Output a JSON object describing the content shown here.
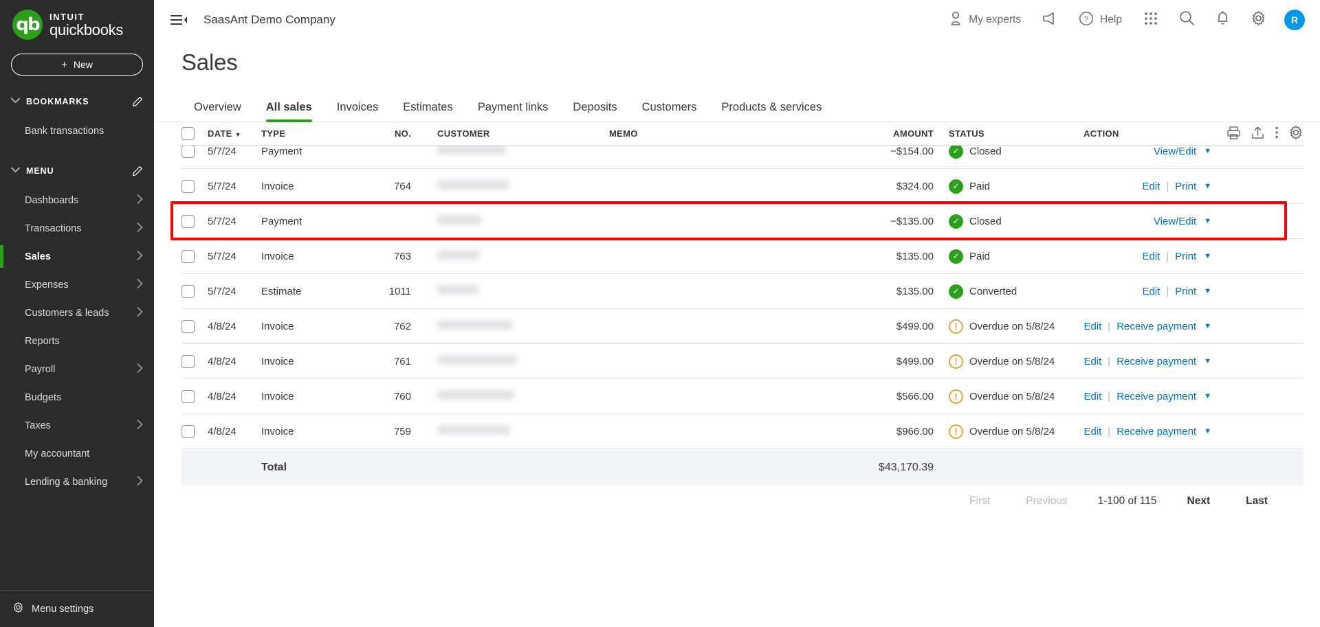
{
  "brand": {
    "intuit": "INTUIT",
    "product": "quickbooks",
    "logo_letters": "qb"
  },
  "sidebar": {
    "new_button": "New",
    "plus": "+",
    "bookmarks_header": "BOOKMARKS",
    "bookmarks": [
      {
        "label": "Bank transactions"
      }
    ],
    "menu_header": "MENU",
    "menu": [
      {
        "label": "Dashboards",
        "has_arrow": true,
        "active": false
      },
      {
        "label": "Transactions",
        "has_arrow": true,
        "active": false
      },
      {
        "label": "Sales",
        "has_arrow": true,
        "active": true
      },
      {
        "label": "Expenses",
        "has_arrow": true,
        "active": false
      },
      {
        "label": "Customers & leads",
        "has_arrow": true,
        "active": false
      },
      {
        "label": "Reports",
        "has_arrow": false,
        "active": false
      },
      {
        "label": "Payroll",
        "has_arrow": true,
        "active": false
      },
      {
        "label": "Budgets",
        "has_arrow": false,
        "active": false
      },
      {
        "label": "Taxes",
        "has_arrow": true,
        "active": false
      },
      {
        "label": "My accountant",
        "has_arrow": false,
        "active": false
      },
      {
        "label": "Lending & banking",
        "has_arrow": true,
        "active": false
      }
    ],
    "menu_settings": "Menu settings"
  },
  "topbar": {
    "company": "SaasAnt Demo Company",
    "my_experts": "My experts",
    "help": "Help",
    "avatar_initial": "R"
  },
  "page": {
    "title": "Sales"
  },
  "tabs": [
    {
      "label": "Overview",
      "active": false
    },
    {
      "label": "All sales",
      "active": true
    },
    {
      "label": "Invoices",
      "active": false
    },
    {
      "label": "Estimates",
      "active": false
    },
    {
      "label": "Payment links",
      "active": false
    },
    {
      "label": "Deposits",
      "active": false
    },
    {
      "label": "Customers",
      "active": false
    },
    {
      "label": "Products & services",
      "active": false
    }
  ],
  "table": {
    "columns": {
      "date": "DATE",
      "sort_caret": "▼",
      "type": "TYPE",
      "no": "NO.",
      "customer": "CUSTOMER",
      "memo": "MEMO",
      "amount": "AMOUNT",
      "status": "STATUS",
      "action": "ACTION"
    },
    "rows": [
      {
        "date": "5/7/24",
        "type": "Payment",
        "no": "",
        "customer_width": 100,
        "amount": "−$154.00",
        "status": "Closed",
        "status_kind": "ok",
        "actions": [
          "View/Edit"
        ],
        "caret": "▼",
        "partial": true,
        "highlighted": false
      },
      {
        "date": "5/7/24",
        "type": "Invoice",
        "no": "764",
        "customer_width": 104,
        "amount": "$324.00",
        "status": "Paid",
        "status_kind": "ok",
        "actions": [
          "Edit",
          "Print"
        ],
        "caret": "▼",
        "partial": false,
        "highlighted": false
      },
      {
        "date": "5/7/24",
        "type": "Payment",
        "no": "",
        "customer_width": 64,
        "amount": "−$135.00",
        "status": "Closed",
        "status_kind": "ok",
        "actions": [
          "View/Edit"
        ],
        "caret": "▼",
        "partial": false,
        "highlighted": true
      },
      {
        "date": "5/7/24",
        "type": "Invoice",
        "no": "763",
        "customer_width": 62,
        "amount": "$135.00",
        "status": "Paid",
        "status_kind": "ok",
        "actions": [
          "Edit",
          "Print"
        ],
        "caret": "▼",
        "partial": false,
        "highlighted": false
      },
      {
        "date": "5/7/24",
        "type": "Estimate",
        "no": "1011",
        "customer_width": 60,
        "amount": "$135.00",
        "status": "Converted",
        "status_kind": "ok",
        "actions": [
          "Edit",
          "Print"
        ],
        "caret": "▼",
        "partial": false,
        "highlighted": false
      },
      {
        "date": "4/8/24",
        "type": "Invoice",
        "no": "762",
        "customer_width": 110,
        "amount": "$499.00",
        "status": "Overdue on 5/8/24",
        "status_kind": "warn",
        "actions": [
          "Edit",
          "Receive payment"
        ],
        "caret": "▼",
        "partial": false,
        "highlighted": false
      },
      {
        "date": "4/8/24",
        "type": "Invoice",
        "no": "761",
        "customer_width": 116,
        "amount": "$499.00",
        "status": "Overdue on 5/8/24",
        "status_kind": "warn",
        "actions": [
          "Edit",
          "Receive payment"
        ],
        "caret": "▼",
        "partial": false,
        "highlighted": false
      },
      {
        "date": "4/8/24",
        "type": "Invoice",
        "no": "760",
        "customer_width": 112,
        "amount": "$566.00",
        "status": "Overdue on 5/8/24",
        "status_kind": "warn",
        "actions": [
          "Edit",
          "Receive payment"
        ],
        "caret": "▼",
        "partial": false,
        "highlighted": false
      },
      {
        "date": "4/8/24",
        "type": "Invoice",
        "no": "759",
        "customer_width": 106,
        "amount": "$966.00",
        "status": "Overdue on 5/8/24",
        "status_kind": "warn",
        "actions": [
          "Edit",
          "Receive payment"
        ],
        "caret": "▼",
        "partial": false,
        "highlighted": false
      }
    ],
    "total_label": "Total",
    "total_amount": "$43,170.39"
  },
  "pagination": {
    "first": "First",
    "previous": "Previous",
    "range": "1-100 of 115",
    "next": "Next",
    "last": "Last"
  },
  "colors": {
    "brand_green": "#2ca01c",
    "link_blue": "#0077c5",
    "warn_orange": "#eaa13a",
    "highlight_red": "#ff0000",
    "sidebar_bg": "#2b2b2b",
    "avatar_blue": "#0097e6"
  }
}
